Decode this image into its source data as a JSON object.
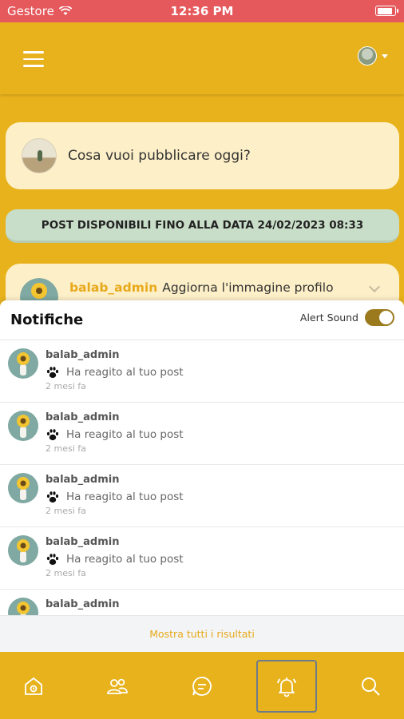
{
  "status_bar": {
    "carrier": "Gestore",
    "time": "12:36 PM"
  },
  "composer": {
    "placeholder": "Cosa vuoi pubblicare oggi?"
  },
  "banner": {
    "text": "POST DISPONIBILI FINO ALLA DATA 24/02/2023 08:33"
  },
  "post": {
    "username": "balab_admin",
    "action": "Aggiorna l'immagine profilo"
  },
  "notifications": {
    "title": "Notifiche",
    "alert_sound_label": "Alert Sound",
    "alert_sound_on": true,
    "items": [
      {
        "user": "balab_admin",
        "message": "Ha reagito al tuo post",
        "time": "2 mesi fa"
      },
      {
        "user": "balab_admin",
        "message": "Ha reagito al tuo post",
        "time": "2 mesi fa"
      },
      {
        "user": "balab_admin",
        "message": "Ha reagito al tuo post",
        "time": "2 mesi fa"
      },
      {
        "user": "balab_admin",
        "message": "Ha reagito al tuo post",
        "time": "2 mesi fa"
      },
      {
        "user": "balab_admin",
        "message": "",
        "time": ""
      }
    ],
    "show_all": "Mostra tutti i risultati"
  },
  "bottom_nav": {
    "items": [
      "home-icon",
      "friends-icon",
      "chat-icon",
      "bell-icon",
      "search-icon"
    ],
    "active": "bell-icon"
  },
  "colors": {
    "primary": "#E8B21C",
    "status_bar": "#E5585C",
    "card": "#FDEFC7",
    "banner": "#C9DEC8",
    "accent_text": "#E8A91A",
    "toggle": "#9B7A1E"
  }
}
